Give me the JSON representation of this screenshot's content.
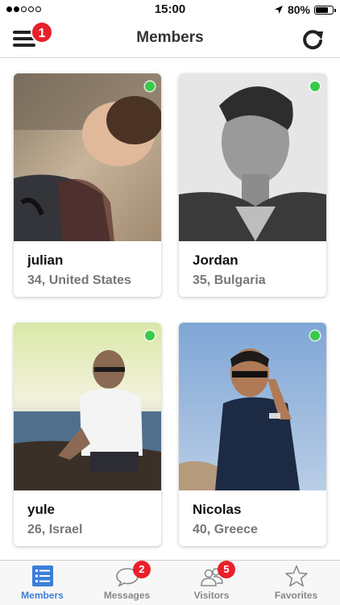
{
  "status_bar": {
    "time": "15:00",
    "battery_text": "80%",
    "battery_level": 0.8,
    "signal_bars_filled": 2,
    "signal_bars_total": 5
  },
  "navbar": {
    "title": "Members",
    "menu_badge": "1",
    "menu_icon": "hamburger-icon",
    "refresh_icon": "refresh-icon"
  },
  "members": [
    {
      "name": "julian",
      "meta": "34, United States",
      "online": true
    },
    {
      "name": "Jordan",
      "meta": "35, Bulgaria",
      "online": true
    },
    {
      "name": "yule",
      "meta": "26, Israel",
      "online": true
    },
    {
      "name": "Nicolas",
      "meta": "40, Greece",
      "online": true
    }
  ],
  "tabs": [
    {
      "label": "Members",
      "icon": "list-icon",
      "badge": "",
      "active": true
    },
    {
      "label": "Messages",
      "icon": "chat-bubble-icon",
      "badge": "2",
      "active": false
    },
    {
      "label": "Visitors",
      "icon": "people-icon",
      "badge": "5",
      "active": false
    },
    {
      "label": "Favorites",
      "icon": "star-icon",
      "badge": "",
      "active": false
    }
  ],
  "colors": {
    "accent": "#3c7ed8",
    "badge": "#e8202a",
    "online": "#38c94a"
  }
}
